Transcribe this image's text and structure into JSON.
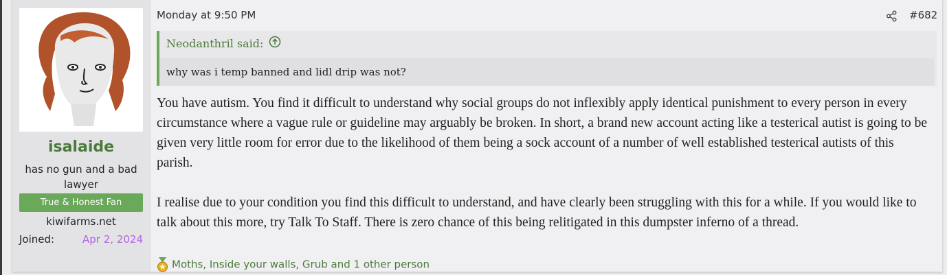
{
  "user": {
    "username": "isalaide",
    "title": "has no gun and a bad lawyer",
    "banner": "True & Honest Fan",
    "site": "kiwifarms.net",
    "joined_label": "Joined:",
    "joined_value": "Apr 2, 2024"
  },
  "post": {
    "date": "Monday at 9:50 PM",
    "number": "#682",
    "quote_author": "Neodanthril said:",
    "quote_text": "why was i temp banned and lidl drip was not?",
    "paragraphs": [
      "You have autism. You find it difficult to understand why social groups do not inflexibly apply identical punishment to every person in every circumstance where a vague rule or guideline may arguably be broken. In short, a brand new account acting like a testerical autist is going to be given very little room for error due to the likelihood of them being a sock account of a number of well established testerical autists of this parish.",
      "I realise due to your condition you find this difficult to understand, and have clearly been struggling with this for a while. If you would like to talk about this more, try Talk To Staff. There is zero chance of this being relitigated in this dumpster inferno of a thread."
    ],
    "reactions": "Moths, Inside your walls, Grub and 1 other person"
  },
  "colors": {
    "accent_green": "#6aa85a",
    "username_green": "#4a7a3a",
    "joined_purple": "#b066e0"
  },
  "icons": {
    "share": "share-icon",
    "quote_up": "arrow-up-circle-icon",
    "reaction": "medal-icon"
  }
}
